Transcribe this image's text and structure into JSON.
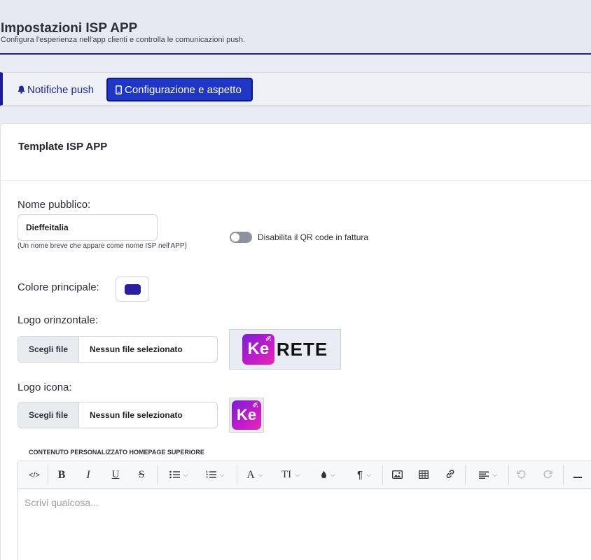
{
  "header": {
    "title": "Impostazioni ISP APP",
    "subtitle": "Configura l'esperienza nell'app clienti e controlla le comunicazioni push."
  },
  "tabs": [
    {
      "label": "Notifiche push",
      "icon": "bell-icon",
      "active": false
    },
    {
      "label": "Configurazione e aspetto",
      "icon": "mobile-icon",
      "active": true
    }
  ],
  "card": {
    "title": "Template ISP APP"
  },
  "form": {
    "public_name": {
      "label": "Nome pubblico:",
      "value": "Dieffeitalia",
      "help": "(Un nome breve che appare come nome ISP nell'APP)"
    },
    "qr_toggle": {
      "label": "Disabilita il QR code in fattura",
      "on": false
    },
    "main_color": {
      "label": "Colore principale:",
      "value": "#2a1fa0"
    },
    "horizontal_logo": {
      "label": "Logo orinzontale:",
      "button": "Scegli file",
      "status": "Nessun file selezionato",
      "preview_mark": "Ke",
      "preview_text": "RETE"
    },
    "icon_logo": {
      "label": "Logo icona:",
      "button": "Scegli file",
      "status": "Nessun file selezionato",
      "preview_mark": "Ke"
    }
  },
  "editor": {
    "label": "CONTENUTO PERSONALIZZATO HOMEPAGE SUPERIORE",
    "placeholder": "Scrivi qualcosa...",
    "toolbar": {
      "code": "</>",
      "bold": "B",
      "italic": "I",
      "underline": "U",
      "strike": "S",
      "font_color": "A",
      "font_size": "TI",
      "paragraph": "¶"
    }
  },
  "colors": {
    "accent": "#1f37c4",
    "brand_purple": "#2d1f8f"
  }
}
